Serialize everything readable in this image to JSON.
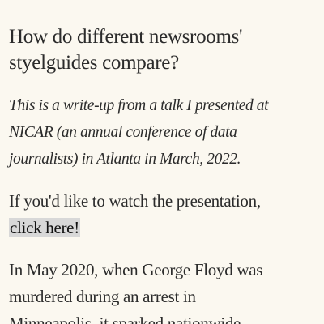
{
  "article": {
    "title": "How do different newsrooms' styelguides compare?",
    "title_lines": [
      "How do different newsrooms'",
      "styelguides compare?"
    ],
    "intro_lines": [
      "This is a write-up from a talk I presented at",
      "NICAR (an annual conference of data",
      "journalists) in Atlanta in March, 2022."
    ],
    "watch_text": "If you'd like to watch the presentation,",
    "watch_link": "click here!",
    "body_lines": [
      "In May 2020, when George Floyd was",
      "murdered during an arrest in",
      "Minneapolis, it sparked nationwide"
    ]
  },
  "colors": {
    "background": "#fbf8f0",
    "text": "#2b2b2b",
    "link_highlight": "#d8d8d8"
  }
}
